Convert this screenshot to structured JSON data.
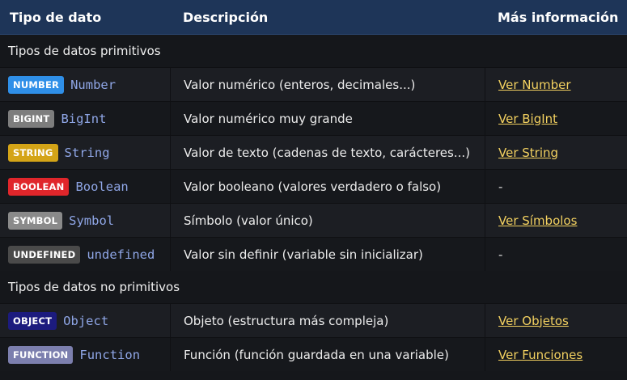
{
  "header": {
    "col_type": "Tipo de dato",
    "col_desc": "Descripción",
    "col_more": "Más información"
  },
  "sections": {
    "primitive": "Tipos de datos primitivos",
    "non_primitive": "Tipos de datos no primitivos"
  },
  "rows": [
    {
      "badge": "NUMBER",
      "badge_color": "#2f8fe8",
      "type": "Number",
      "desc": "Valor numérico (enteros, decimales...)",
      "link": "Ver Number"
    },
    {
      "badge": "BIGINT",
      "badge_color": "#7d7d7d",
      "type": "BigInt",
      "desc": "Valor numérico muy grande",
      "link": "Ver BigInt"
    },
    {
      "badge": "STRING",
      "badge_color": "#d4a417",
      "type": "String",
      "desc": "Valor de texto (cadenas de texto, carácteres...)",
      "link": "Ver String"
    },
    {
      "badge": "BOOLEAN",
      "badge_color": "#e0262b",
      "type": "Boolean",
      "desc": "Valor booleano (valores verdadero o falso)",
      "link": "-"
    },
    {
      "badge": "SYMBOL",
      "badge_color": "#8a8a8a",
      "type": "Symbol",
      "desc": "Símbolo (valor único)",
      "link": "Ver Símbolos"
    },
    {
      "badge": "UNDEFINED",
      "badge_color": "#4a4a4a",
      "type": "undefined",
      "desc": "Valor sin definir (variable sin inicializar)",
      "link": "-"
    },
    {
      "badge": "OBJECT",
      "badge_color": "#1c1b7e",
      "type": "Object",
      "desc": "Objeto (estructura más compleja)",
      "link": "Ver Objetos"
    },
    {
      "badge": "FUNCTION",
      "badge_color": "#7c7fae",
      "type": "Function",
      "desc": "Función (función guardada en una variable)",
      "link": "Ver Funciones"
    }
  ]
}
